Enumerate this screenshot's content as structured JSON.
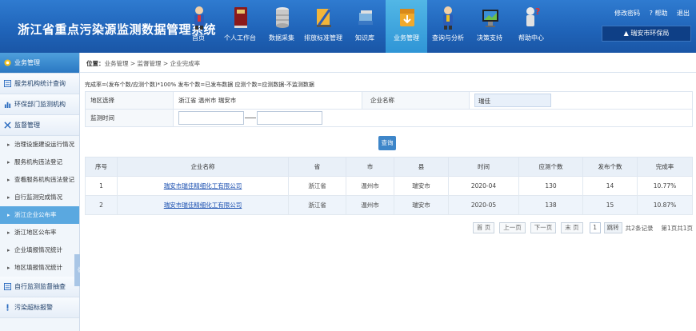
{
  "header": {
    "title": "浙江省重点污染源监测数据管理系统",
    "nav": [
      {
        "label": "首页",
        "icon": "person-icon"
      },
      {
        "label": "个人工作台",
        "icon": "book-icon"
      },
      {
        "label": "数据采集",
        "icon": "database-icon"
      },
      {
        "label": "排放标准管理",
        "icon": "ruler-icon"
      },
      {
        "label": "知识库",
        "icon": "stack-icon"
      },
      {
        "label": "业务管理",
        "icon": "download-box-icon"
      },
      {
        "label": "查询与分析",
        "icon": "person-search-icon"
      },
      {
        "label": "决策支持",
        "icon": "monitor-icon"
      },
      {
        "label": "帮助中心",
        "icon": "help-person-icon"
      }
    ],
    "active_nav": "业务管理",
    "links": {
      "change_password": "修改密码",
      "help": "? 帮助",
      "logout": "退出"
    },
    "department": "▲ 瑞安市环保局"
  },
  "sidebar": {
    "sections": [
      {
        "label": "业务管理",
        "icon": "circle-badge-icon"
      },
      {
        "label": "服务机构统计查询",
        "icon": "list-icon"
      },
      {
        "label": "环保部门监测机构",
        "icon": "chart-icon"
      },
      {
        "label": "监督管理",
        "icon": "tools-icon"
      }
    ],
    "sub_items": [
      "治理设施建设运行情况",
      "服务机构违法登记",
      "查看服务机构违法登记",
      "自行监测完成情况",
      "浙江企业公布率",
      "浙江地区公布率",
      "企业填报情况统计",
      "地区填报情况统计"
    ],
    "active_sub": "浙江企业公布率",
    "bottom_sections": [
      {
        "label": "自行监测监督抽查",
        "icon": "list-icon"
      },
      {
        "label": "污染超标报警",
        "icon": "alert-icon"
      }
    ],
    "collapse_glyph": "《"
  },
  "breadcrumb": {
    "label": "位置：",
    "path": "业务管理 > 监督管理 > 企业完成率"
  },
  "note": "完成率=(发布个数/应测个数)*100% 发布个数=已发布数据 应测个数=应测数据-不监测数据",
  "filter": {
    "region_label": "地区选择",
    "region_value": "浙江省 温州市 瑞安市",
    "company_label": "企业名称",
    "company_value": "瑞佳",
    "time_label": "监测时间",
    "start_date": "",
    "end_date": ""
  },
  "query_button": "查询",
  "table": {
    "columns": [
      "序号",
      "企业名称",
      "省",
      "市",
      "县",
      "时间",
      "应测个数",
      "发布个数",
      "完成率"
    ],
    "rows": [
      {
        "no": "1",
        "company": "瑞安市瑞佳精细化工有限公司",
        "province": "浙江省",
        "city": "温州市",
        "county": "瑞安市",
        "time": "2020-04",
        "expected": "130",
        "published": "14",
        "rate": "10.77%"
      },
      {
        "no": "2",
        "company": "瑞安市瑞佳精细化工有限公司",
        "province": "浙江省",
        "city": "温州市",
        "county": "瑞安市",
        "time": "2020-05",
        "expected": "138",
        "published": "15",
        "rate": "10.87%"
      }
    ]
  },
  "pager": {
    "first": "首 页",
    "prev": "上一页",
    "next": "下一页",
    "last": "末 页",
    "page_input": "1",
    "go": "跳转",
    "total": "共2条记录",
    "page_info": "第1页共1页"
  }
}
